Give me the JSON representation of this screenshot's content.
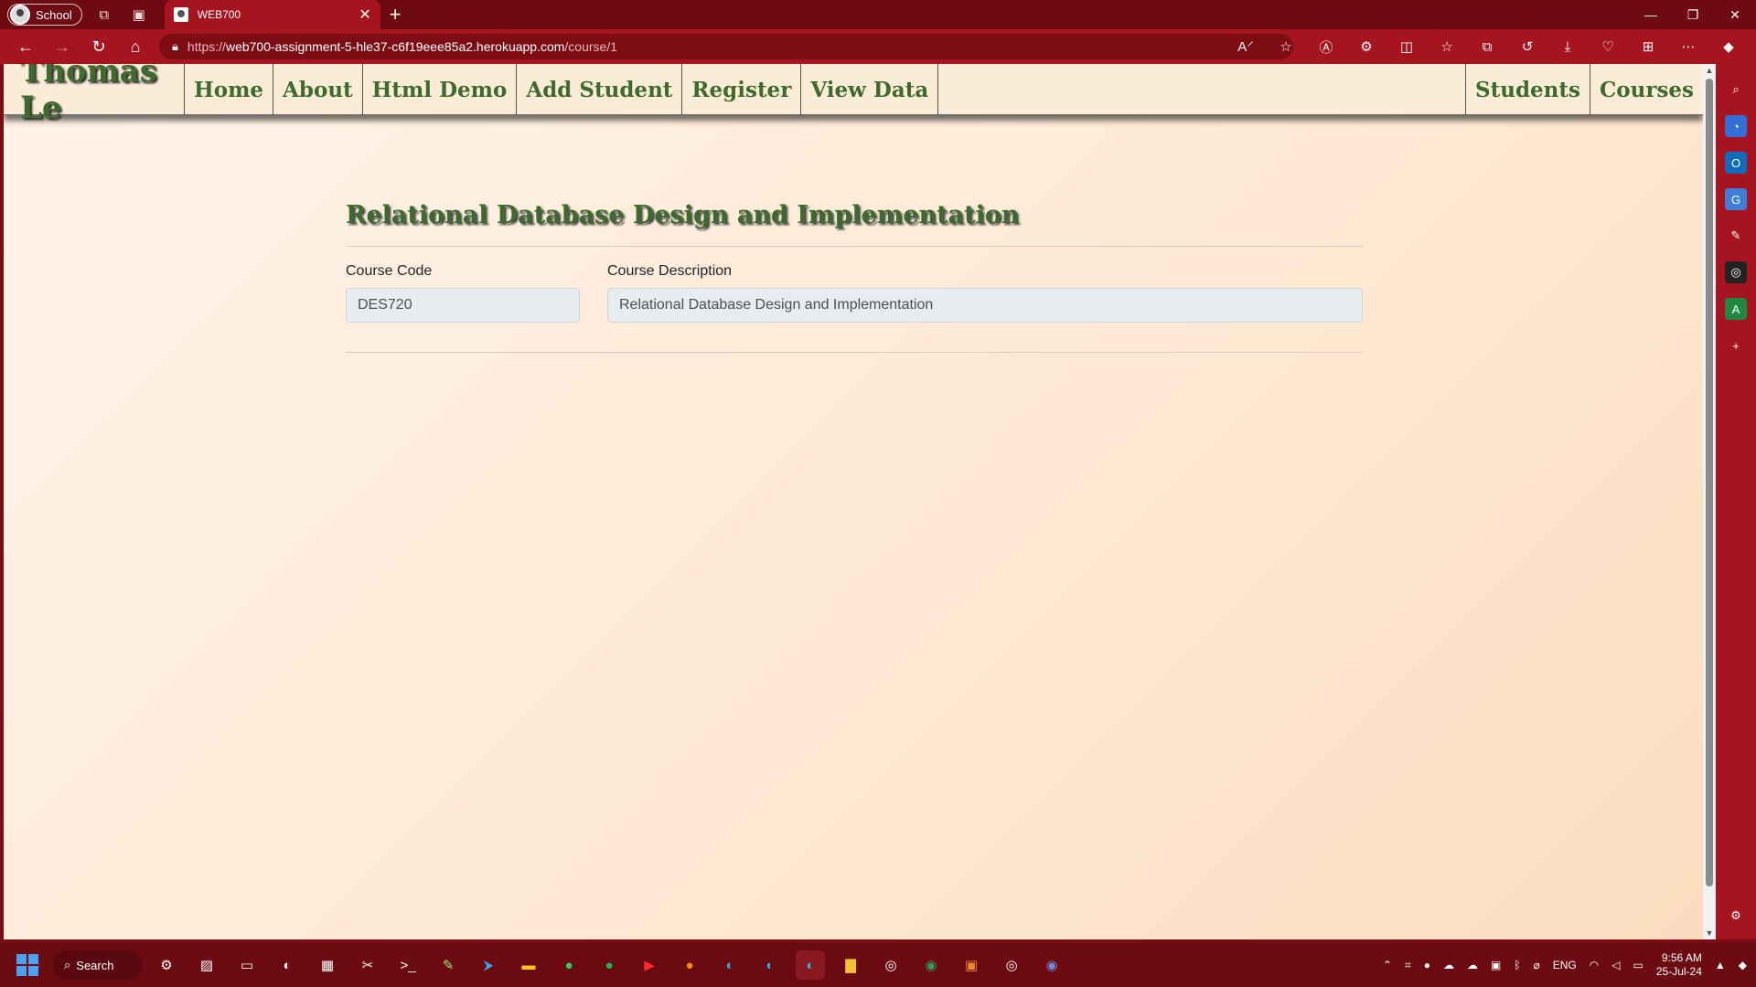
{
  "browser": {
    "profile_label": "School",
    "tab_title": "WEB700",
    "url_prefix": "https://",
    "url_host": "web700-assignment-5-hle37-c6f19eee85a2.herokuapp.com",
    "url_path": "/course/1"
  },
  "navbar": {
    "brand": "Thomas Le",
    "left_items": [
      "Home",
      "About",
      "Html Demo",
      "Add Student",
      "Register",
      "View Data"
    ],
    "right_items": [
      "Students",
      "Courses"
    ]
  },
  "course": {
    "title": "Relational Database Design and Implementation",
    "code_label": "Course Code",
    "code_value": "DES720",
    "description_label": "Course Description",
    "description_value": "Relational Database Design and Implementation"
  },
  "taskbar": {
    "search_label": "Search",
    "language": "ENG",
    "time": "9:56 AM",
    "date": "25-Jul-24"
  },
  "colors": {
    "nav_text": "#3f6a2e",
    "browser_frame": "#a6141f",
    "page_bg": "#fde8d2"
  }
}
